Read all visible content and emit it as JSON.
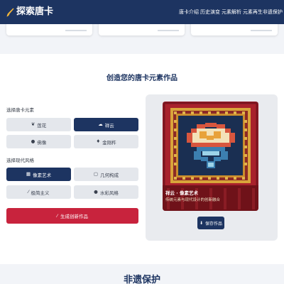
{
  "nav": {
    "brand": "探索唐卡",
    "links": [
      "唐卡介绍",
      "历史演变",
      "元素解析",
      "元素再生",
      "非遗保护"
    ]
  },
  "create": {
    "title": "创造您的唐卡元素作品",
    "element_label": "选择唐卡元素",
    "elements": [
      {
        "label": "莲花",
        "icon": "leaf-icon",
        "active": false
      },
      {
        "label": "祥云",
        "icon": "cloud-icon",
        "active": true
      },
      {
        "label": "佛像",
        "icon": "buddha-icon",
        "active": false
      },
      {
        "label": "金刚杵",
        "icon": "vajra-icon",
        "active": false
      }
    ],
    "style_label": "选择现代风格",
    "styles": [
      {
        "label": "像素艺术",
        "icon": "grid-icon",
        "active": true
      },
      {
        "label": "几何构成",
        "icon": "shape-icon",
        "active": false
      },
      {
        "label": "极简主义",
        "icon": "brush-icon",
        "active": false
      },
      {
        "label": "水彩风格",
        "icon": "drop-icon",
        "active": false
      }
    ],
    "generate_label": "生成创新作品"
  },
  "preview": {
    "caption_title": "祥云 · 像素艺术",
    "caption_sub": "传统元素与现代设计的创新融合",
    "save_label": "保存作品"
  },
  "next_section": {
    "title": "非遗保护"
  },
  "colors": {
    "navy": "#1d3461",
    "crimson": "#c8233d",
    "gold": "#d9a53a"
  }
}
